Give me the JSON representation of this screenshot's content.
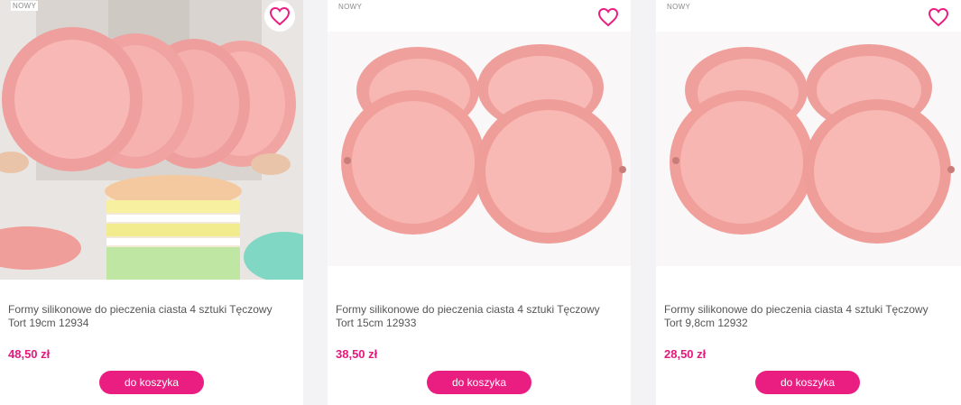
{
  "products": [
    {
      "badge": "NOWY",
      "title": "Formy silikonowe do pieczenia ciasta 4 sztuki Tęczowy Tort 19cm 12934",
      "price": "48,50 zł",
      "cart_label": "do koszyka",
      "image_icon": "cake-pans-photo",
      "favorite_icon": "heart-icon"
    },
    {
      "badge": "NOWY",
      "title": "Formy silikonowe do pieczenia ciasta 4 sztuki Tęczowy Tort 15cm 12933",
      "price": "38,50 zł",
      "cart_label": "do koszyka",
      "image_icon": "cake-pans-photo",
      "favorite_icon": "heart-icon"
    },
    {
      "badge": "NOWY",
      "title": "Formy silikonowe do pieczenia ciasta 4 sztuki Tęczowy Tort 9,8cm 12932",
      "price": "28,50 zł",
      "cart_label": "do koszyka",
      "image_icon": "cake-pans-photo",
      "favorite_icon": "heart-icon"
    }
  ],
  "colors": {
    "accent": "#e91e80",
    "price": "#e3197d",
    "pan": "#f4a3a3"
  }
}
